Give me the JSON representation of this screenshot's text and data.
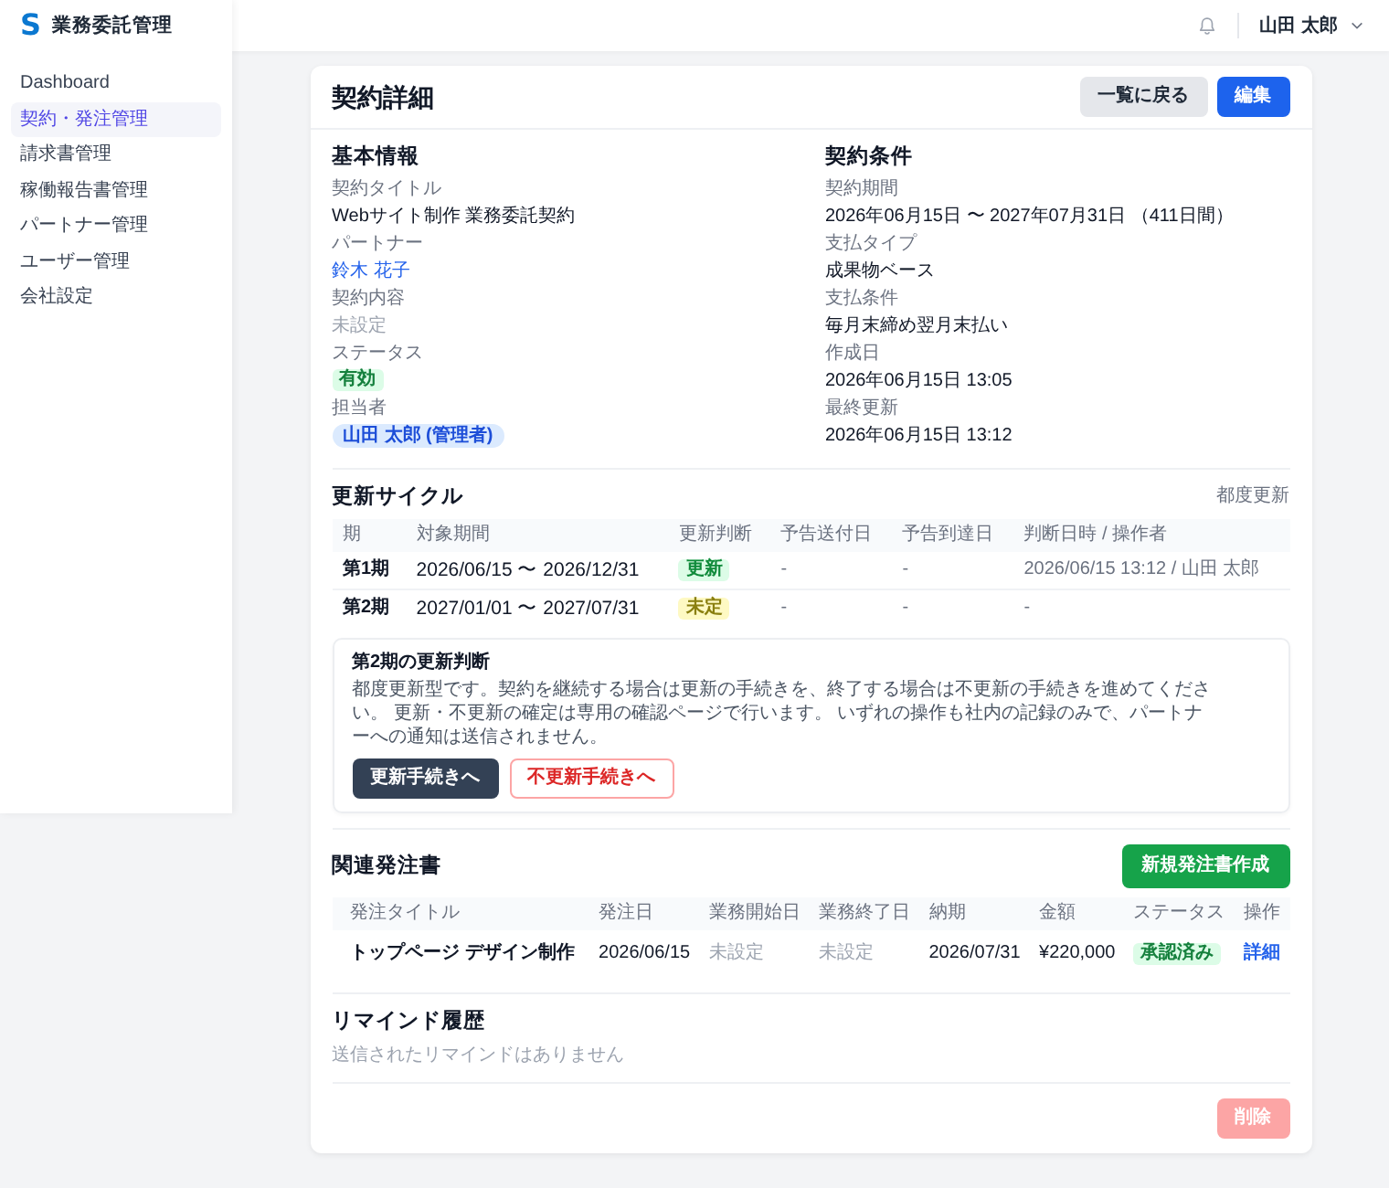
{
  "app": {
    "logo": "S",
    "name": "業務委託管理"
  },
  "sidebar": {
    "items": [
      {
        "label": "Dashboard",
        "selected": false
      },
      {
        "label": "契約・発注管理",
        "selected": true
      },
      {
        "label": "請求書管理",
        "selected": false
      },
      {
        "label": "稼働報告書管理",
        "selected": false
      },
      {
        "label": "パートナー管理",
        "selected": false
      },
      {
        "label": "ユーザー管理",
        "selected": false
      },
      {
        "label": "会社設定",
        "selected": false
      }
    ]
  },
  "header": {
    "user": "山田 太郎"
  },
  "page": {
    "title": "契約詳細",
    "buttons": [
      {
        "label": "一覧に戻る",
        "kind": "secondary"
      },
      {
        "label": "編集",
        "kind": "primary"
      }
    ]
  },
  "basic_info": {
    "heading": "基本情報",
    "fields": [
      {
        "label": "契約タイトル",
        "value": "Webサイト制作 業務委託契約",
        "kind": "text"
      },
      {
        "label": "パートナー",
        "value": "鈴木 花子",
        "kind": "link"
      },
      {
        "label": "契約内容",
        "value": "未設定",
        "kind": "muted"
      },
      {
        "label": "ステータス",
        "value": "有効",
        "kind": "status"
      },
      {
        "label": "担当者",
        "value": "山田 太郎 (管理者)",
        "kind": "tag"
      }
    ]
  },
  "terms": {
    "heading": "契約条件",
    "fields": [
      {
        "label": "契約期間",
        "value": "2026年06月15日 〜 2027年07月31日 （411日間）",
        "kind": "text"
      },
      {
        "label": "支払タイプ",
        "value": "成果物ベース",
        "kind": "text"
      },
      {
        "label": "支払条件",
        "value": "毎月末締め翌月末払い",
        "kind": "text"
      },
      {
        "label": "作成日",
        "value": "2026年06月15日 13:05",
        "kind": "text"
      },
      {
        "label": "最終更新",
        "value": "2026年06月15日 13:12",
        "kind": "text"
      }
    ]
  },
  "renewal_cycle": {
    "heading": "更新サイクル",
    "type": "都度更新",
    "columns": [
      "期",
      "対象期間",
      "更新判断",
      "予告送付日",
      "予告到達日",
      "判断日時 / 操作者"
    ],
    "rows": [
      {
        "period": "第1期",
        "range": "2026/06/15 〜 2026/12/31",
        "decision": "更新",
        "color": "#dcfce7",
        "notice_sent": "-",
        "notice_arrived": "-",
        "decided": "2026/06/15 13:12 / 山田 太郎"
      },
      {
        "period": "第2期",
        "range": "2027/01/01 〜 2027/07/31",
        "decision": "未定",
        "color": "#fef9c3",
        "notice_sent": "-",
        "notice_arrived": "-",
        "decided": "-"
      }
    ],
    "notice": {
      "title": "第2期の更新判断",
      "text": "都度更新型です。契約を継続する場合は更新の手続きを、終了する場合は不更新の手続きを進めてください。 更新・不更新の確定は専用の確認ページで行います。 いずれの操作も社内の記録のみで、パートナーへの通知は送信されません。",
      "buttons": [
        {
          "label": "更新手続きへ",
          "kind": "renew"
        },
        {
          "label": "不更新手続きへ",
          "kind": "decline"
        }
      ]
    }
  },
  "related_orders": {
    "heading": "関連発注書",
    "button": "新規発注書作成",
    "columns": [
      "発注タイトル",
      "発注日",
      "業務開始日",
      "業務終了日",
      "納期",
      "金額",
      "ステータス",
      "操作"
    ],
    "rows": [
      {
        "cells": [
          {
            "kind": "title",
            "text": "トップページ デザイン制作"
          },
          {
            "kind": "text",
            "text": "2026/06/15"
          },
          {
            "kind": "muted",
            "text": "未設定"
          },
          {
            "kind": "muted",
            "text": "未設定"
          },
          {
            "kind": "text",
            "text": "2026/07/31"
          },
          {
            "kind": "text",
            "text": "¥220,000"
          },
          {
            "kind": "status",
            "text": "承認済み"
          },
          {
            "kind": "link",
            "text": "詳細"
          }
        ]
      }
    ]
  },
  "reminders": {
    "heading": "リマインド履歴",
    "empty_text": "送信されたリマインドはありません"
  },
  "footer": {
    "delete_button": {
      "label": "削除",
      "disabled": true
    }
  }
}
